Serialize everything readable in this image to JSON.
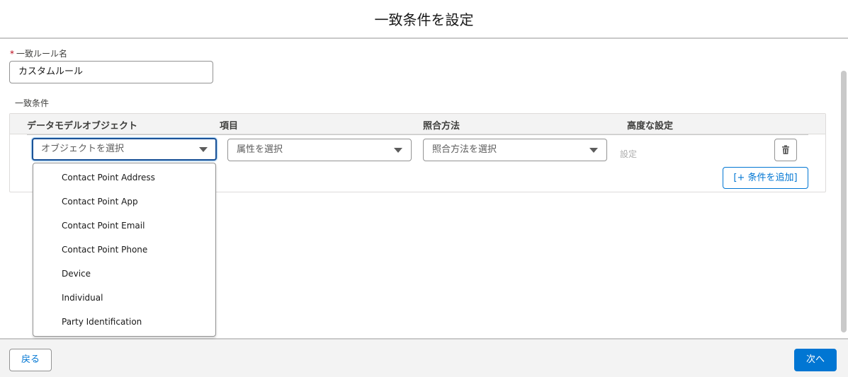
{
  "modal": {
    "title": "一致条件を設定"
  },
  "form": {
    "rule_name_label": "一致ルール名",
    "required_mark": "*",
    "rule_name_value": "カスタムルール",
    "conditions_label": "一致条件"
  },
  "table": {
    "columns": [
      "データモデルオブジェクト",
      "項目",
      "照合方法",
      "高度な設定"
    ],
    "row": {
      "object_placeholder": "オブジェクトを選択",
      "attribute_placeholder": "属性を選択",
      "method_placeholder": "照合方法を選択",
      "advanced_text": "設定"
    },
    "add_condition_label": "[+ 条件を追加]"
  },
  "dropdown": {
    "options": [
      "Contact Point Address",
      "Contact Point App",
      "Contact Point Email",
      "Contact Point Phone",
      "Device",
      "Individual",
      "Party Identification"
    ]
  },
  "footer": {
    "back_label": "戻る",
    "next_label": "次へ"
  },
  "icons": {
    "delete": "trash-icon",
    "select_caret": "caret-down-icon"
  },
  "colors": {
    "brand": "#0176d3",
    "focus_border": "#1b5297",
    "required": "#ba0517"
  }
}
